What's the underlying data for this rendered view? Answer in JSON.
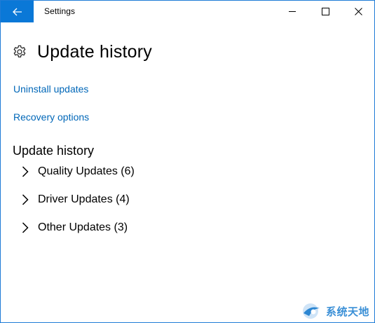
{
  "window": {
    "title": "Settings",
    "controls": {
      "minimize_icon": "minimize-icon",
      "maximize_icon": "maximize-icon",
      "close_icon": "close-icon"
    },
    "back_icon": "back-arrow-icon",
    "accent_color": "#0a78d7"
  },
  "page": {
    "title": "Update history",
    "title_icon": "gear-icon",
    "links": [
      {
        "label": "Uninstall updates"
      },
      {
        "label": "Recovery options"
      }
    ],
    "link_color": "#0067b8"
  },
  "history": {
    "section_title": "Update history",
    "groups": [
      {
        "label": "Quality Updates (6)",
        "icon": "chevron-right-icon"
      },
      {
        "label": "Driver Updates (4)",
        "icon": "chevron-right-icon"
      },
      {
        "label": "Other Updates (3)",
        "icon": "chevron-right-icon"
      }
    ]
  },
  "watermark": {
    "text": "系统天地",
    "icon": "watermark-logo-icon"
  }
}
